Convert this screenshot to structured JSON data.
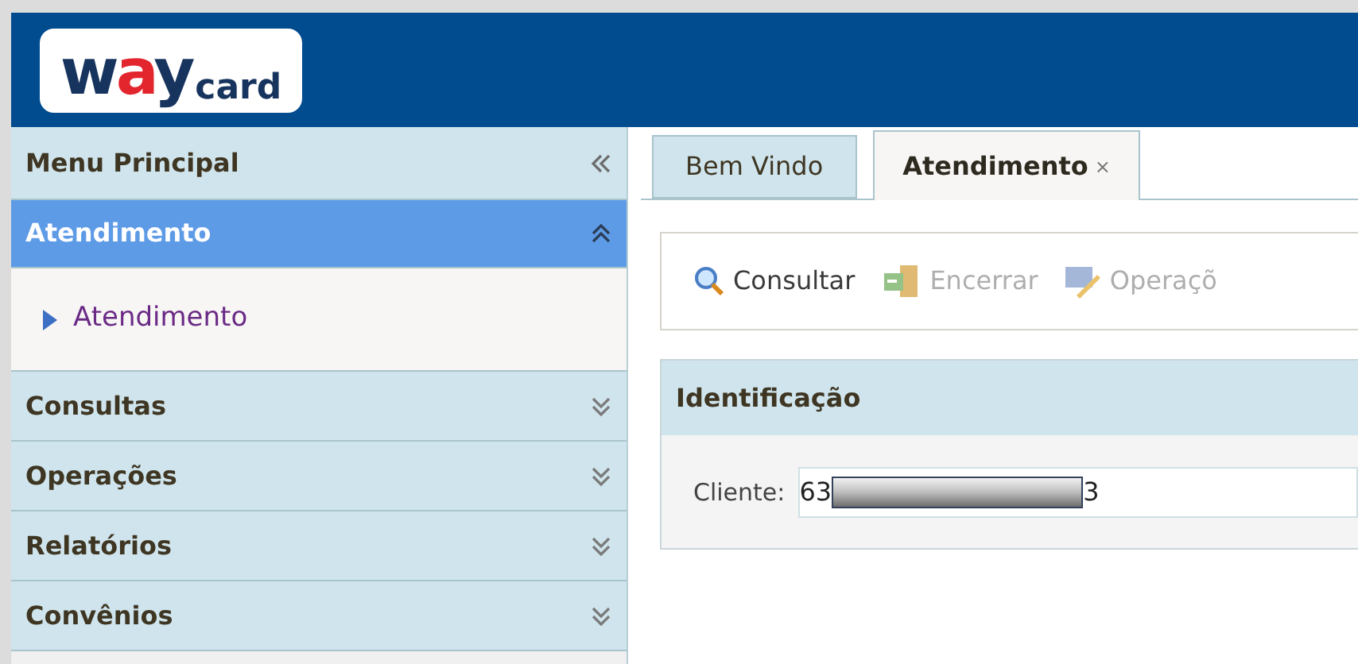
{
  "logo": {
    "lead": "w",
    "accent": "a",
    "tail": "y",
    "suffix": "card"
  },
  "sidebar": {
    "title": "Menu Principal",
    "sections": [
      {
        "label": "Atendimento",
        "expanded": true,
        "items": [
          {
            "label": "Atendimento"
          }
        ]
      },
      {
        "label": "Consultas",
        "expanded": false
      },
      {
        "label": "Operações",
        "expanded": false
      },
      {
        "label": "Relatórios",
        "expanded": false
      },
      {
        "label": "Convênios",
        "expanded": false
      }
    ]
  },
  "tabs": [
    {
      "label": "Bem Vindo",
      "selected": false,
      "closable": false
    },
    {
      "label": "Atendimento",
      "selected": true,
      "closable": true,
      "close": "×"
    }
  ],
  "toolbar": [
    {
      "kind": "search",
      "label": "Consultar",
      "disabled": false
    },
    {
      "kind": "exit",
      "label": "Encerrar",
      "disabled": true
    },
    {
      "kind": "edit",
      "label": "Operaçõ",
      "disabled": true
    }
  ],
  "panel": {
    "title": "Identificação",
    "field": {
      "label": "Cliente:",
      "value_start": "63",
      "redacted": true,
      "value_end": "3"
    }
  }
}
